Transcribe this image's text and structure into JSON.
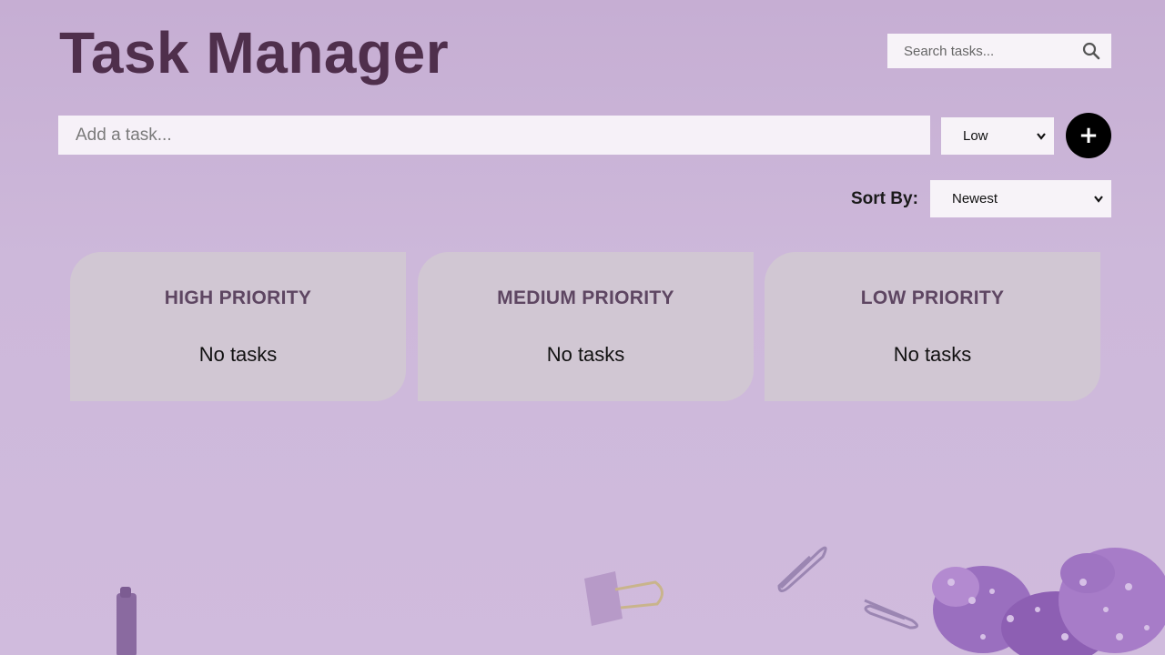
{
  "header": {
    "title": "Task Manager",
    "search_placeholder": "Search tasks..."
  },
  "add_task": {
    "placeholder": "Add a task...",
    "priority_selected": "Low",
    "add_button_label": "+"
  },
  "sort": {
    "label": "Sort By:",
    "selected": "Newest"
  },
  "columns": [
    {
      "title": "HIGH PRIORITY",
      "empty_text": "No tasks"
    },
    {
      "title": "MEDIUM PRIORITY",
      "empty_text": "No tasks"
    },
    {
      "title": "LOW PRIORITY",
      "empty_text": "No tasks"
    }
  ],
  "colors": {
    "background": "#cdb8da",
    "title": "#4f2f4c",
    "column_bg": "#d2c8d2",
    "column_title": "#5e4662",
    "add_button": "#000000"
  },
  "icons": {
    "search": "search-icon",
    "chevron": "chevron-down-icon",
    "add": "plus-icon"
  }
}
